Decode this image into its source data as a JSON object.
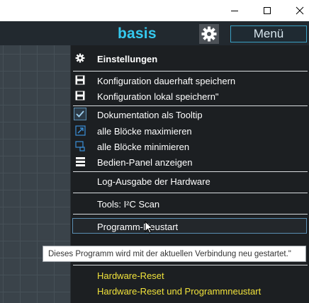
{
  "window": {
    "minimize_glyph": "—",
    "maximize_glyph": "☐",
    "close_glyph": "✕"
  },
  "header": {
    "brand": "basis",
    "settings_icon": "gear-icon",
    "menu_label": "Menü",
    "brand_color": "#35c9ef"
  },
  "menu": {
    "settings_title": "Einstellungen",
    "items": {
      "save_permanent": "Konfiguration dauerhaft speichern",
      "save_local": "Konfiguration lokal speichern\"",
      "doc_tooltip": "Dokumentation als Tooltip",
      "maximize_all": "alle Blöcke maximieren",
      "minimize_all": "alle Blöcke minimieren",
      "control_panel": "Bedien-Panel anzeigen",
      "log_output": "Log-Ausgabe der Hardware",
      "i2c_scan": "Tools: I²C Scan",
      "program_restart": "Programm-Neustart",
      "hardware_reset": "Hardware-Reset",
      "hardware_reset_restart": "Hardware-Reset und Programmneustart"
    },
    "doc_tooltip_checked": true,
    "accent_color": "#f0e23b"
  },
  "tooltip": {
    "text": "Dieses Programm wird mit der aktuellen Verbindung neu gestartet.\""
  }
}
